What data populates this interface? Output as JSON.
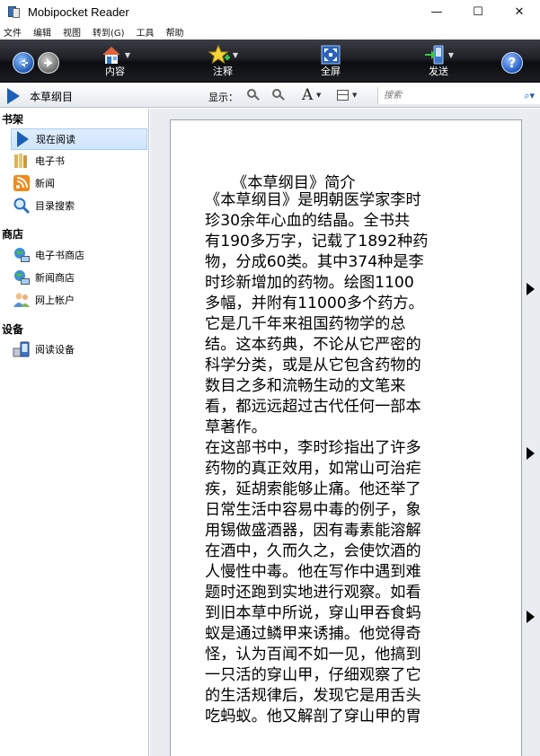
{
  "window": {
    "title": "Mobipocket Reader",
    "minimize": "—",
    "maximize": "☐",
    "close": "✕"
  },
  "menu": [
    "文件",
    "编辑",
    "视图",
    "转到(G)",
    "工具",
    "帮助"
  ],
  "toolbar": {
    "tools": [
      {
        "label": "内容",
        "icon": "home-icon"
      },
      {
        "label": "注释",
        "icon": "star-annotate-icon"
      },
      {
        "label": "全屏",
        "icon": "fullscreen-icon"
      },
      {
        "label": "发送",
        "icon": "send-device-icon"
      }
    ],
    "help": "?"
  },
  "subbar": {
    "breadcrumb": "本草纲目",
    "display_label": "显示：",
    "font_glyph": "A",
    "search_placeholder": "搜索"
  },
  "sidebar": {
    "sections": [
      {
        "title": "书架",
        "items": [
          "现在阅读",
          "电子书",
          "新闻",
          "目录搜索"
        ]
      },
      {
        "title": "商店",
        "items": [
          "电子书商店",
          "新闻商店",
          "网上帐户"
        ]
      },
      {
        "title": "设备",
        "items": [
          "阅读设备"
        ]
      }
    ]
  },
  "book": {
    "title": "《本草纲目》简介",
    "lines": [
      "《本草纲目》是明朝医学家李时",
      "珍30余年心血的结晶。全书共",
      "有190多万字，记载了1892种药",
      "物，分成60类。其中374种是李",
      "时珍新增加的药物。绘图1100",
      "多幅，并附有11000多个药方。",
      "它是几千年来祖国药物学的总",
      "结。这本药典，不论从它严密的",
      "科学分类，或是从它包含药物的",
      "数目之多和流畅生动的文笔来",
      "看，都远远超过古代任何一部本",
      "草著作。",
      "在这部书中，李时珍指出了许多",
      "药物的真正效用，如常山可治疟",
      "疾，延胡索能够止痛。他还举了",
      "日常生活中容易中毒的例子，象",
      "用锡做盛酒器，因有毒素能溶解",
      "在酒中，久而久之，会使饮酒的",
      "人慢性中毒。他在写作中遇到难",
      "题时还跑到实地进行观察。如看",
      "到旧本草中所说，穿山甲吞食蚂",
      "蚁是通过鳞甲来诱捕。他觉得奇",
      "怪，认为百闻不如一见，他搞到",
      "一只活的穿山甲，仔细观察了它",
      "的生活规律后，发现它是用舌头",
      "吃蚂蚁。他又解剖了穿山甲的胃"
    ]
  }
}
